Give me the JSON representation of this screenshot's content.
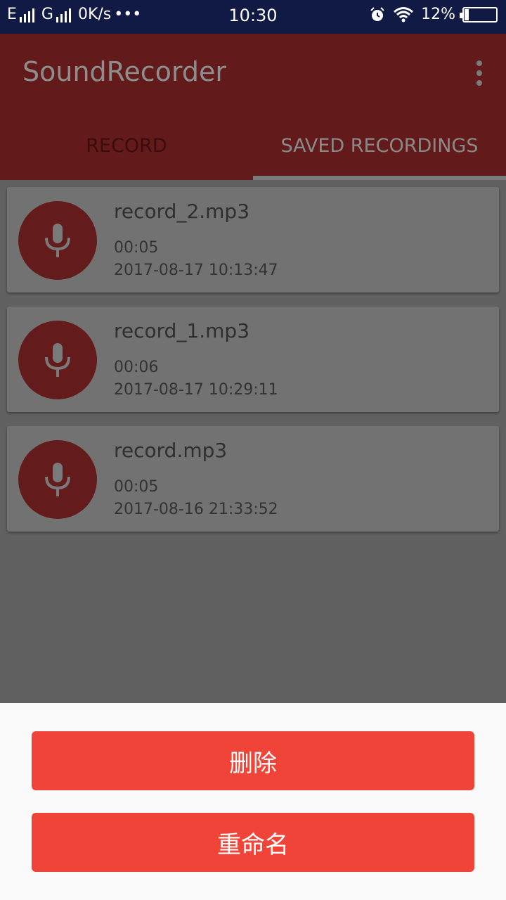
{
  "status_bar": {
    "sim1_label": "E",
    "sim2_label": "G",
    "network_speed": "0K/s",
    "dots": "•••",
    "time": "10:30",
    "battery_text": "12%",
    "battery_level": 0.12,
    "icons": [
      "signal-icon",
      "alarm-icon",
      "wifi-icon",
      "battery-icon"
    ]
  },
  "app_bar": {
    "title": "SoundRecorder",
    "menu_icon": "more-vert-icon"
  },
  "tabs": [
    {
      "label": "RECORD",
      "selected": false
    },
    {
      "label": "SAVED RECORDINGS",
      "selected": true
    }
  ],
  "recordings": [
    {
      "name": "record_2.mp3",
      "duration": "00:05",
      "date": "2017-08-17 10:13:47"
    },
    {
      "name": "record_1.mp3",
      "duration": "00:06",
      "date": "2017-08-17 10:29:11"
    },
    {
      "name": "record.mp3",
      "duration": "00:05",
      "date": "2017-08-16 21:33:52"
    }
  ],
  "action_sheet": {
    "delete_label": "删除",
    "rename_label": "重命名"
  },
  "colors": {
    "status_bar": "#111a45",
    "app_bar_dimmed": "#621a1a",
    "button_accent": "#f04438",
    "sheet_background": "#fafafa"
  }
}
